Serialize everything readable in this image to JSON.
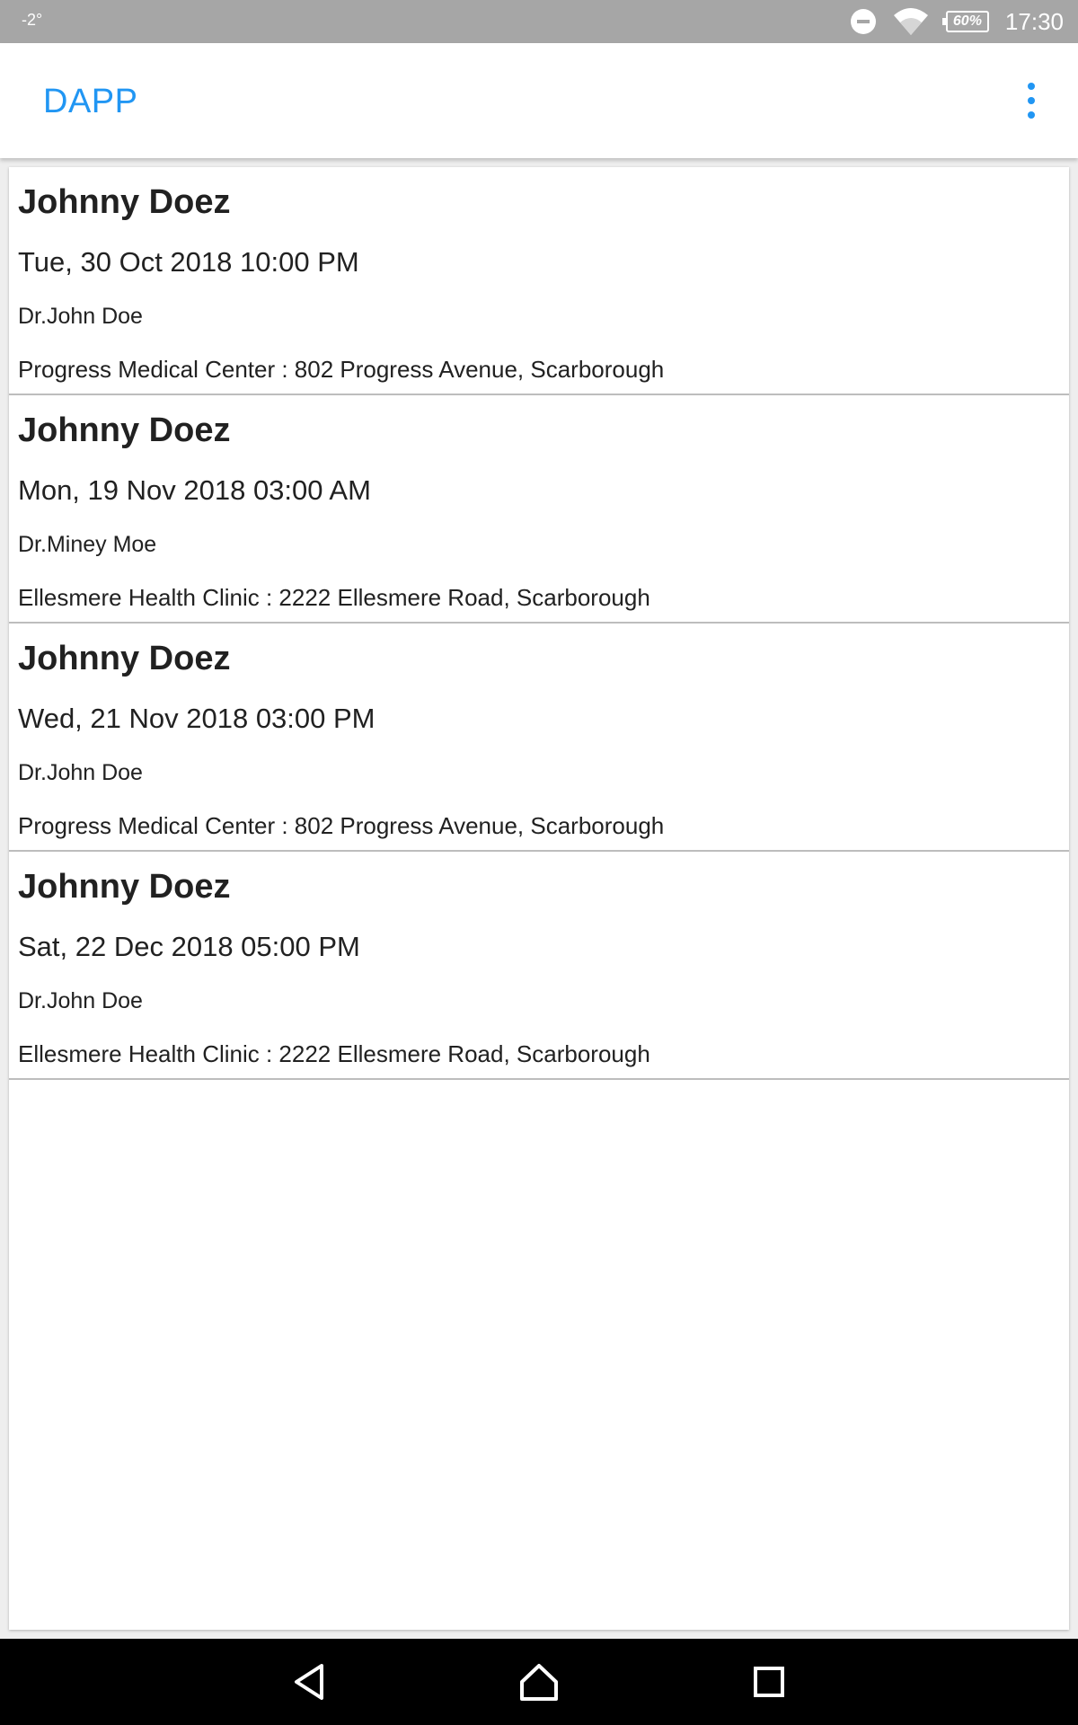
{
  "status_bar": {
    "temperature": "-2°",
    "battery": "60%",
    "time": "17:30",
    "icons": [
      "do-not-disturb-icon",
      "wifi-icon",
      "battery-icon"
    ]
  },
  "app_bar": {
    "title": "DAPP",
    "accent_color": "#2196f3",
    "menu_icon": "overflow-menu-icon"
  },
  "appointments": [
    {
      "patient": "Johnny Doez",
      "datetime": "Tue, 30 Oct 2018 10:00 PM",
      "doctor": "Dr.John Doe",
      "location": "Progress Medical Center : 802 Progress Avenue, Scarborough"
    },
    {
      "patient": "Johnny Doez",
      "datetime": "Mon, 19 Nov 2018 03:00 AM",
      "doctor": "Dr.Miney Moe",
      "location": "Ellesmere Health Clinic : 2222 Ellesmere Road, Scarborough"
    },
    {
      "patient": "Johnny Doez",
      "datetime": "Wed, 21 Nov 2018 03:00 PM",
      "doctor": "Dr.John Doe",
      "location": "Progress Medical Center : 802 Progress Avenue, Scarborough"
    },
    {
      "patient": "Johnny Doez",
      "datetime": "Sat, 22 Dec 2018 05:00 PM",
      "doctor": "Dr.John Doe",
      "location": "Ellesmere Health Clinic : 2222 Ellesmere Road, Scarborough"
    }
  ],
  "nav_bar": {
    "icons": [
      "back-icon",
      "home-icon",
      "recents-icon"
    ]
  }
}
